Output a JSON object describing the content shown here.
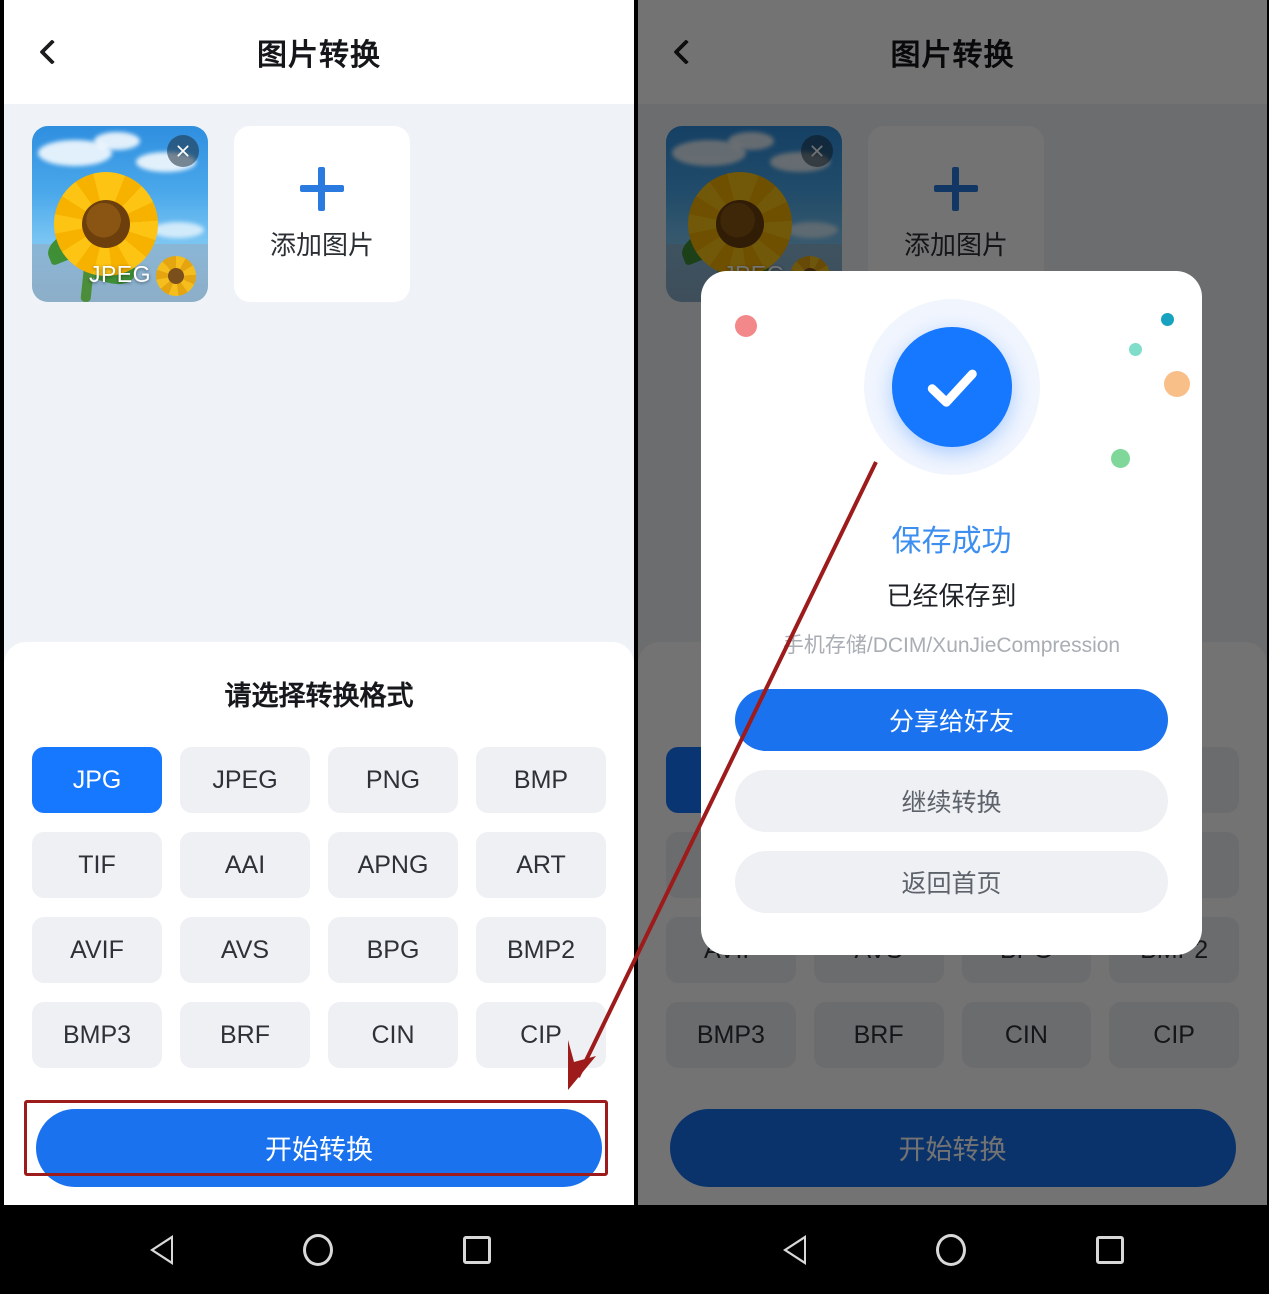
{
  "app": {
    "title": "图片转换",
    "back_icon": "chevron-left-icon"
  },
  "thumbnails": {
    "image_label": "JPEG",
    "close_icon": "close-icon",
    "add_card": {
      "plus_icon": "plus-icon",
      "label": "添加图片"
    }
  },
  "format_panel": {
    "title": "请选择转换格式",
    "selected": "JPG",
    "options": [
      "JPG",
      "JPEG",
      "PNG",
      "BMP",
      "TIF",
      "AAI",
      "APNG",
      "ART",
      "AVIF",
      "AVS",
      "BPG",
      "BMP2",
      "BMP3",
      "BRF",
      "CIN",
      "CIP"
    ]
  },
  "cta": {
    "label": "开始转换"
  },
  "dialog": {
    "success_icon": "check-circle-icon",
    "title": "保存成功",
    "subtitle": "已经保存到",
    "path": "手机存储/DCIM/XunJieCompression",
    "buttons": [
      {
        "label": "分享给好友",
        "style": "primary"
      },
      {
        "label": "继续转换",
        "style": "ghost"
      },
      {
        "label": "返回首页",
        "style": "ghost"
      }
    ]
  },
  "navbar": {
    "back_icon": "triangle-back-icon",
    "home_icon": "circle-home-icon",
    "recents_icon": "square-recents-icon"
  },
  "annotation": {
    "highlight_color": "#9e1b1b",
    "arrow_color": "#9e1b1b"
  },
  "colors": {
    "accent": "#1677ff",
    "cta": "#1a72ee",
    "page_bg": "#eff2f7",
    "chip_bg": "#eef0f4"
  }
}
